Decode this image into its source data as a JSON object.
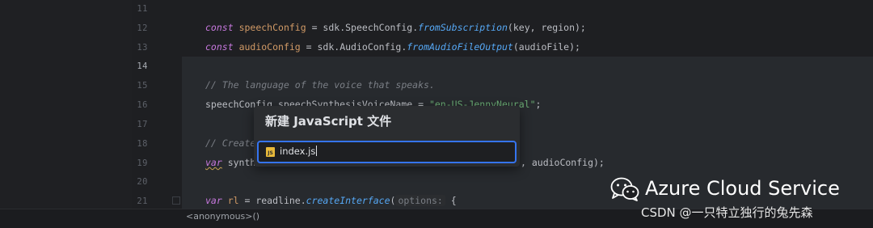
{
  "editor": {
    "line_numbers": [
      "11",
      "12",
      "13",
      "14",
      "15",
      "16",
      "17",
      "18",
      "19",
      "20",
      "21"
    ],
    "current_line": "14",
    "code": {
      "l12": {
        "kw": "const",
        "var": "speechConfig",
        "op": " = sdk.SpeechConfig.",
        "fn": "fromSubscription",
        "tail": "(key, region);"
      },
      "l13": {
        "kw": "const",
        "var": "audioConfig",
        "op": " = sdk.AudioConfig.",
        "fn": "fromAudioFileOutput",
        "tail": "(audioFile);"
      },
      "l15": {
        "comment": "// The language of the voice that speaks."
      },
      "l16": {
        "head": "speechConfig.speechSynthesisVoiceName = ",
        "str": "\"en-US-JennyNeural\"",
        "tail": ";"
      },
      "l18": {
        "comment": "// Create"
      },
      "l19": {
        "kw": "var",
        "head": " synth",
        "tail": ", audioConfig);"
      },
      "l21": {
        "kw": "var",
        "var": " rl",
        "op": " = readline.",
        "fn": "createInterface",
        "paren": "(",
        "hint": "options:",
        "tail": " {"
      }
    }
  },
  "breadcrumb": {
    "text": "<anonymous>()"
  },
  "dialog": {
    "title": "新建 JavaScript 文件",
    "input_value": "index.js",
    "file_icon_label": "JS",
    "file_icon": "js-file-icon"
  },
  "watermark": {
    "icon": "wechat-icon",
    "title": "Azure Cloud Service",
    "subtitle": "CSDN @一只特立独行的兔先森"
  }
}
